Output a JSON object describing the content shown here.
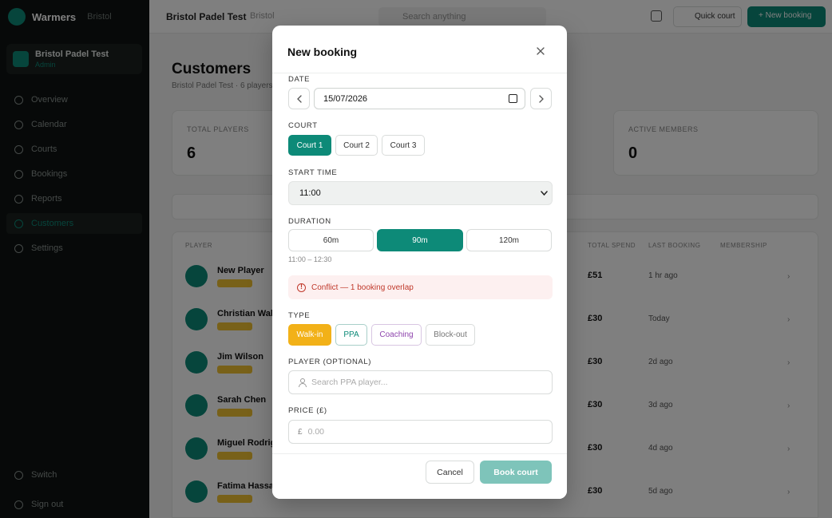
{
  "app": {
    "brand": "Warmers",
    "brand_sub": "Bristol",
    "club_name": "Bristol Padel Test",
    "club_sub": "Admin"
  },
  "sidebar": {
    "items": [
      {
        "label": "Overview"
      },
      {
        "label": "Calendar"
      },
      {
        "label": "Courts"
      },
      {
        "label": "Bookings"
      },
      {
        "label": "Reports"
      },
      {
        "label": "Customers"
      },
      {
        "label": "Settings"
      }
    ],
    "bottom": [
      {
        "label": "Switch"
      },
      {
        "label": "Sign out"
      }
    ]
  },
  "topbar": {
    "title": "Bristol Padel Test",
    "crumb": "Bristol",
    "search_placeholder": "Search anything",
    "secondary_label": "Quick court",
    "primary_label": "+ New booking"
  },
  "page": {
    "title": "Customers",
    "subtitle": "Bristol Padel Test · 6 players",
    "stats": [
      {
        "label": "TOTAL PLAYERS",
        "value": "6"
      },
      {
        "label": "ACTIVE MEMBERS",
        "value": "0"
      }
    ],
    "table_headers": [
      "PLAYER",
      "TOTAL SPEND",
      "LAST BOOKING",
      "MEMBERSHIP"
    ],
    "rows": [
      {
        "name": "New Player",
        "total": "£51",
        "last": "1 hr ago"
      },
      {
        "name": "Christian Walker",
        "total": "£30",
        "last": "Today"
      },
      {
        "name": "Jim Wilson",
        "total": "£30",
        "last": "2d ago"
      },
      {
        "name": "Sarah Chen",
        "total": "£30",
        "last": "3d ago"
      },
      {
        "name": "Miguel Rodriguez",
        "total": "£30",
        "last": "4d ago"
      },
      {
        "name": "Fatima Hassan",
        "total": "£30",
        "last": "5d ago"
      }
    ]
  },
  "modal": {
    "title": "New booking",
    "date_label": "DATE",
    "date_value": "15/07/2026",
    "court_label": "COURT",
    "courts": [
      "Court 1",
      "Court 2",
      "Court 3"
    ],
    "selected_court": "Court 1",
    "start_label": "START TIME",
    "start_value": "11:00",
    "duration_label": "DURATION",
    "durations": [
      "60m",
      "90m",
      "120m"
    ],
    "selected_duration": "90m",
    "time_range": "11:00 – 12:30",
    "conflict": "Conflict — 1 booking overlap",
    "type_label": "TYPE",
    "types": [
      "Walk-in",
      "PPA",
      "Coaching",
      "Block-out"
    ],
    "selected_type": "Walk-in",
    "player_label": "PLAYER (OPTIONAL)",
    "player_placeholder": "Search PPA player...",
    "price_label": "PRICE (£)",
    "currency_symbol": "£",
    "price_placeholder": "0.00",
    "cancel_label": "Cancel",
    "book_label": "Book court"
  },
  "colors": {
    "accent": "#0d8a78",
    "walkin": "#f2b118",
    "coaching": "#8e44ad",
    "conflict": "#c0392b",
    "book_disabled": "#7ec4ba"
  }
}
